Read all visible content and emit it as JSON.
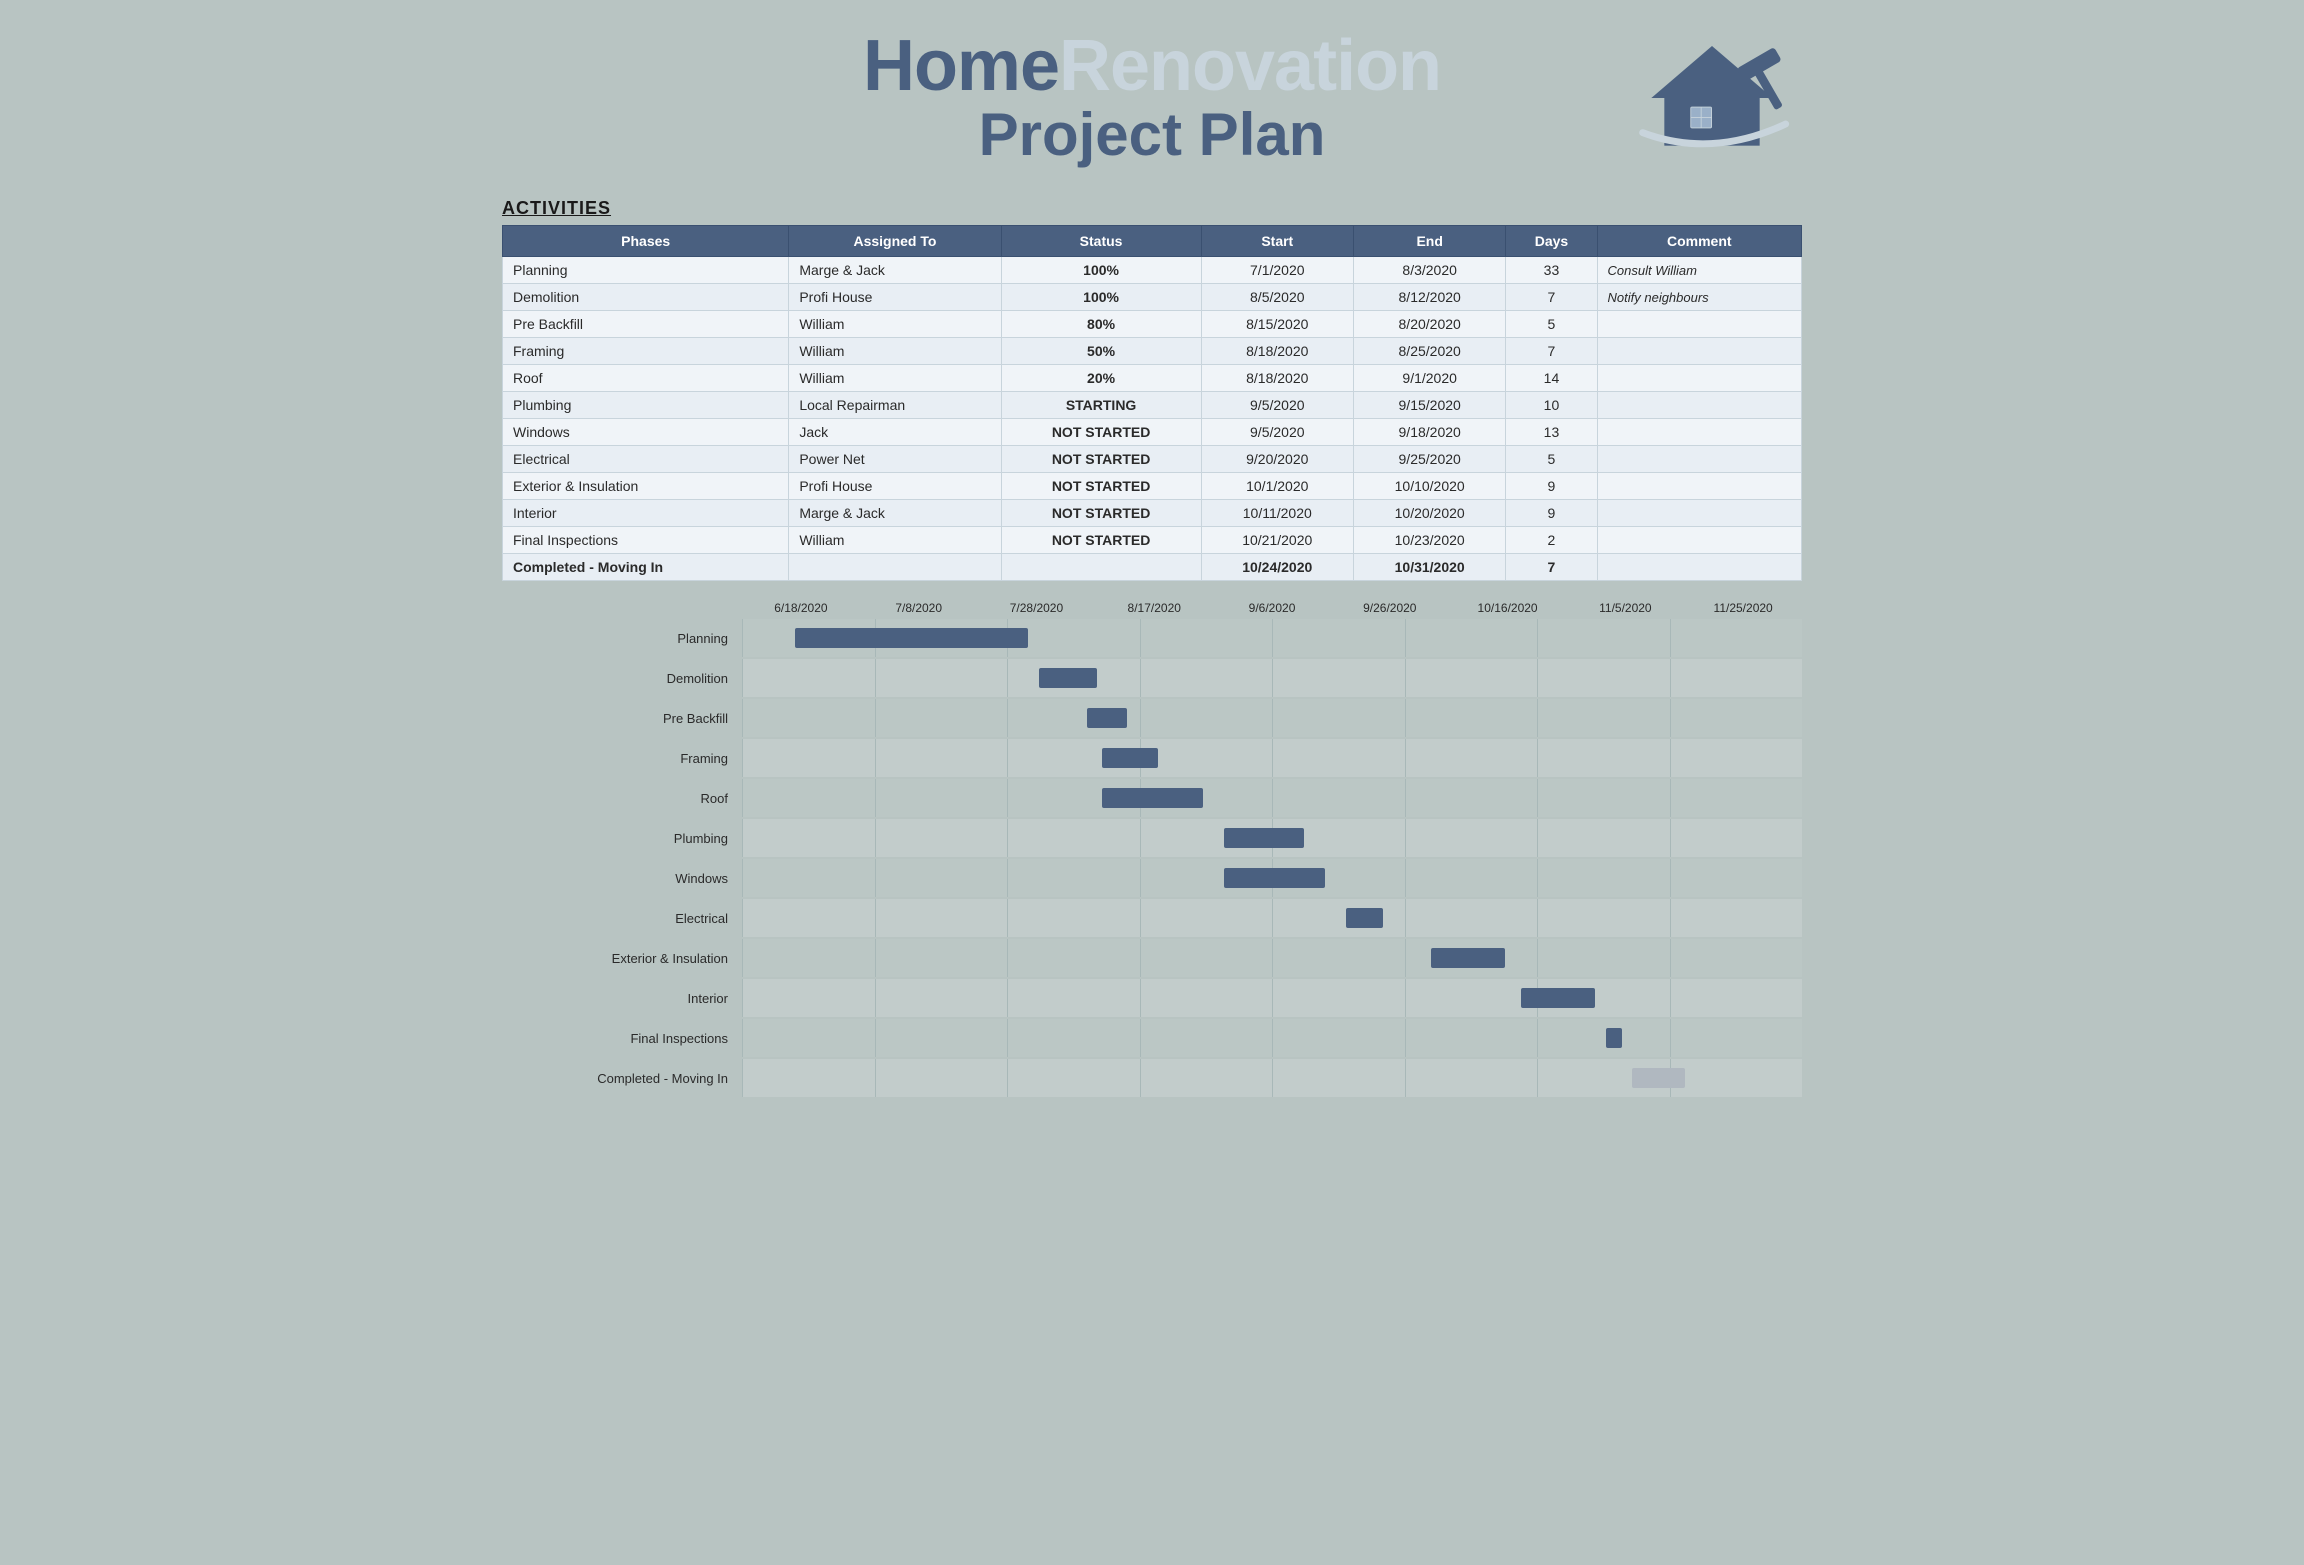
{
  "header": {
    "title_line1_home": "Home",
    "title_line1_renovation": "Renovation",
    "title_line2": "Project Plan"
  },
  "activities_label": "ACTIVITIES",
  "table": {
    "columns": [
      "Phases",
      "Assigned To",
      "Status",
      "Start",
      "End",
      "Days",
      "Comment"
    ],
    "rows": [
      {
        "phase": "Planning",
        "assigned": "Marge & Jack",
        "status": "100%",
        "status_class": "status-100",
        "start": "7/1/2020",
        "end": "8/3/2020",
        "days": "33",
        "comment": "Consult William"
      },
      {
        "phase": "Demolition",
        "assigned": "Profi House",
        "status": "100%",
        "status_class": "status-100",
        "start": "8/5/2020",
        "end": "8/12/2020",
        "days": "7",
        "comment": "Notify neighbours"
      },
      {
        "phase": "Pre Backfill",
        "assigned": "William",
        "status": "80%",
        "status_class": "status-80",
        "start": "8/15/2020",
        "end": "8/20/2020",
        "days": "5",
        "comment": ""
      },
      {
        "phase": "Framing",
        "assigned": "William",
        "status": "50%",
        "status_class": "status-50",
        "start": "8/18/2020",
        "end": "8/25/2020",
        "days": "7",
        "comment": ""
      },
      {
        "phase": "Roof",
        "assigned": "William",
        "status": "20%",
        "status_class": "status-20",
        "start": "8/18/2020",
        "end": "9/1/2020",
        "days": "14",
        "comment": ""
      },
      {
        "phase": "Plumbing",
        "assigned": "Local Repairman",
        "status": "STARTING",
        "status_class": "status-starting",
        "start": "9/5/2020",
        "end": "9/15/2020",
        "days": "10",
        "comment": ""
      },
      {
        "phase": "Windows",
        "assigned": "Jack",
        "status": "NOT STARTED",
        "status_class": "status-notstarted",
        "start": "9/5/2020",
        "end": "9/18/2020",
        "days": "13",
        "comment": ""
      },
      {
        "phase": "Electrical",
        "assigned": "Power Net",
        "status": "NOT STARTED",
        "status_class": "status-notstarted",
        "start": "9/20/2020",
        "end": "9/25/2020",
        "days": "5",
        "comment": ""
      },
      {
        "phase": "Exterior & Insulation",
        "assigned": "Profi House",
        "status": "NOT STARTED",
        "status_class": "status-notstarted",
        "start": "10/1/2020",
        "end": "10/10/2020",
        "days": "9",
        "comment": ""
      },
      {
        "phase": "Interior",
        "assigned": "Marge & Jack",
        "status": "NOT STARTED",
        "status_class": "status-notstarted",
        "start": "10/11/2020",
        "end": "10/20/2020",
        "days": "9",
        "comment": ""
      },
      {
        "phase": "Final Inspections",
        "assigned": "William",
        "status": "NOT STARTED",
        "status_class": "status-notstarted",
        "start": "10/21/2020",
        "end": "10/23/2020",
        "days": "2",
        "comment": ""
      },
      {
        "phase": "Completed - Moving In",
        "assigned": "",
        "status": "",
        "status_class": "",
        "start": "10/24/2020",
        "end": "10/31/2020",
        "days": "7",
        "comment": "",
        "bold": true
      }
    ]
  },
  "gantt": {
    "date_labels": [
      "6/18/2020",
      "7/8/2020",
      "7/28/2020",
      "8/17/2020",
      "9/6/2020",
      "9/26/2020",
      "10/16/2020",
      "11/5/2020",
      "11/25/2020"
    ],
    "rows": [
      {
        "label": "Planning",
        "bar_start_pct": 5.0,
        "bar_width_pct": 22.0,
        "bar_type": "blue"
      },
      {
        "label": "Demolition",
        "bar_start_pct": 28.0,
        "bar_width_pct": 5.5,
        "bar_type": "blue"
      },
      {
        "label": "Pre Backfill",
        "bar_start_pct": 32.5,
        "bar_width_pct": 3.8,
        "bar_type": "blue"
      },
      {
        "label": "Framing",
        "bar_start_pct": 34.0,
        "bar_width_pct": 5.2,
        "bar_type": "blue"
      },
      {
        "label": "Roof",
        "bar_start_pct": 34.0,
        "bar_width_pct": 9.5,
        "bar_type": "blue"
      },
      {
        "label": "Plumbing",
        "bar_start_pct": 45.5,
        "bar_width_pct": 7.5,
        "bar_type": "blue"
      },
      {
        "label": "Windows",
        "bar_start_pct": 45.5,
        "bar_width_pct": 9.5,
        "bar_type": "blue"
      },
      {
        "label": "Electrical",
        "bar_start_pct": 57.0,
        "bar_width_pct": 3.5,
        "bar_type": "blue"
      },
      {
        "label": "Exterior & Insulation",
        "bar_start_pct": 65.0,
        "bar_width_pct": 7.0,
        "bar_type": "blue"
      },
      {
        "label": "Interior",
        "bar_start_pct": 73.5,
        "bar_width_pct": 7.0,
        "bar_type": "blue"
      },
      {
        "label": "Final Inspections",
        "bar_start_pct": 81.5,
        "bar_width_pct": 1.5,
        "bar_type": "blue"
      },
      {
        "label": "Completed - Moving In",
        "bar_start_pct": 84.0,
        "bar_width_pct": 5.0,
        "bar_type": "gray"
      }
    ]
  }
}
